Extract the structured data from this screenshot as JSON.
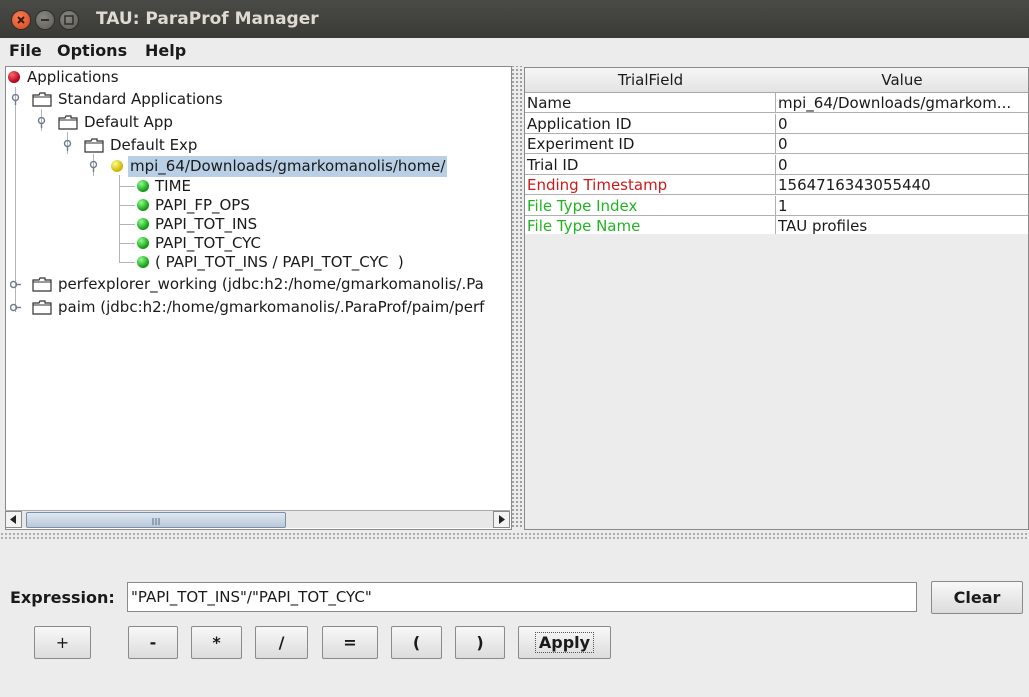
{
  "window": {
    "title": "TAU: ParaProf Manager"
  },
  "menu": [
    "File",
    "Options",
    "Help"
  ],
  "tree": {
    "root": "Applications",
    "standard_apps": "Standard Applications",
    "default_app": "Default App",
    "default_exp": "Default Exp",
    "trial": "mpi_64/Downloads/gmarkomanolis/home/",
    "metrics": [
      "TIME",
      "PAPI_FP_OPS",
      "PAPI_TOT_INS",
      "PAPI_TOT_CYC",
      "( PAPI_TOT_INS / PAPI_TOT_CYC  )"
    ],
    "db1": "perfexplorer_working (jdbc:h2:/home/gmarkomanolis/.Pa",
    "db2": "paim (jdbc:h2:/home/gmarkomanolis/.ParaProf/paim/perf"
  },
  "table": {
    "headers": [
      "TrialField",
      "Value"
    ],
    "rows": [
      {
        "field": "Name",
        "value": "mpi_64/Downloads/gmarkom...",
        "color": "#1a1a1a"
      },
      {
        "field": "Application ID",
        "value": "0",
        "color": "#1a1a1a"
      },
      {
        "field": "Experiment ID",
        "value": "0",
        "color": "#1a1a1a"
      },
      {
        "field": "Trial ID",
        "value": "0",
        "color": "#1a1a1a"
      },
      {
        "field": "Ending Timestamp",
        "value": "1564716343055440",
        "color": "#cc1a1a"
      },
      {
        "field": "File Type Index",
        "value": "1",
        "color": "#22b422"
      },
      {
        "field": "File Type Name",
        "value": "TAU profiles",
        "color": "#22b422"
      }
    ]
  },
  "expression": {
    "label": "Expression:",
    "value": "\"PAPI_TOT_INS\"/\"PAPI_TOT_CYC\""
  },
  "buttons": {
    "clear": "Clear",
    "plus": "+",
    "minus": "-",
    "times": "*",
    "divide": "/",
    "equals": "=",
    "lparen": "(",
    "rparen": ")",
    "apply": "Apply"
  }
}
